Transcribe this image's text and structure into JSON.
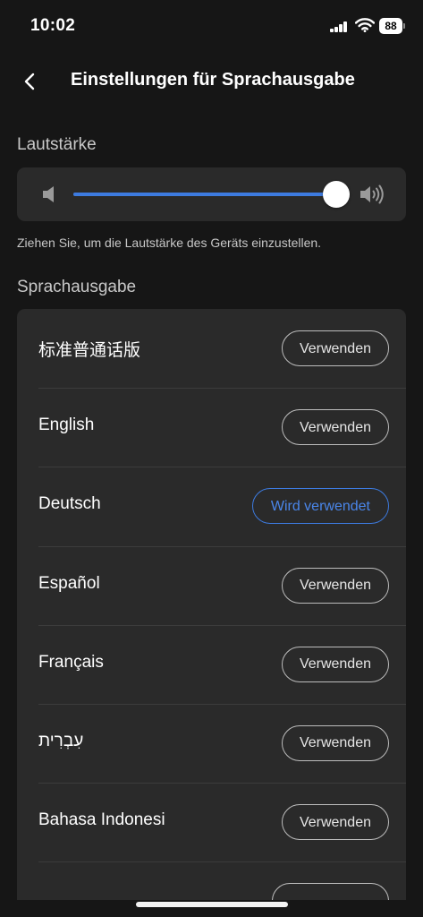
{
  "status_bar": {
    "time": "10:02",
    "battery": "88",
    "icons": [
      "signal-icon",
      "wifi-icon",
      "battery-icon"
    ]
  },
  "nav": {
    "back_icon": "chevron-left-icon",
    "title": "Einstellungen für Sprachausgabe"
  },
  "volume": {
    "section_label": "Lautstärke",
    "level": 1.0,
    "low_icon": "speaker-low-icon",
    "high_icon": "speaker-high-icon",
    "hint": "Ziehen Sie, um die Lautstärke des Geräts einzustellen."
  },
  "voices": {
    "section_label": "Sprachausgabe",
    "items": [
      {
        "name": "标准普通话版",
        "button": "Verwenden",
        "active": false
      },
      {
        "name": "English",
        "button": "Verwenden",
        "active": false
      },
      {
        "name": "Deutsch",
        "button": "Wird verwendet",
        "active": true
      },
      {
        "name": "Español",
        "button": "Verwenden",
        "active": false
      },
      {
        "name": "Français",
        "button": "Verwenden",
        "active": false
      },
      {
        "name": "עִבְרִית",
        "button": "Verwenden",
        "active": false
      },
      {
        "name": "Bahasa Indonesi",
        "button": "Verwenden",
        "active": false
      }
    ]
  },
  "colors": {
    "accent": "#3d7be0",
    "background": "#161616",
    "card": "#2a2a2a"
  }
}
